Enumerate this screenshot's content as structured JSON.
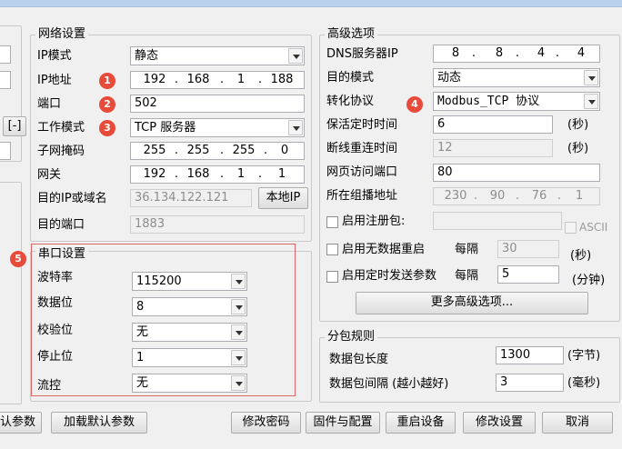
{
  "network": {
    "title": "网络设置",
    "ip_mode_label": "IP模式",
    "ip_mode_value": "静态",
    "ip_label": "IP地址",
    "ip": [
      "192",
      "168",
      "1",
      "188"
    ],
    "port_label": "端口",
    "port_value": "502",
    "work_mode_label": "工作模式",
    "work_mode_value": "TCP 服务器",
    "subnet_label": "子网掩码",
    "subnet": [
      "255",
      "255",
      "255",
      "0"
    ],
    "gateway_label": "网关",
    "gateway": [
      "192",
      "168",
      "1",
      "1"
    ],
    "dest_label": "目的IP或域名",
    "dest_value": "36.134.122.121",
    "local_ip_button": "本地IP",
    "dest_port_label": "目的端口",
    "dest_port_value": "1883"
  },
  "left_partial": {
    "bracket_button": "[-]"
  },
  "serial": {
    "title": "串口设置",
    "baud_label": "波特率",
    "baud_value": "115200",
    "databits_label": "数据位",
    "databits_value": "8",
    "parity_label": "校验位",
    "parity_value": "无",
    "stopbits_label": "停止位",
    "stopbits_value": "1",
    "flow_label": "流控",
    "flow_value": "无"
  },
  "advanced": {
    "title": "高级选项",
    "dns_label": "DNS服务器IP",
    "dns": [
      "8",
      "8",
      "4",
      "4"
    ],
    "dest_mode_label": "目的模式",
    "dest_mode_value": "动态",
    "protocol_label": "转化协议",
    "protocol_value": "Modbus_TCP 协议",
    "keepalive_label": "保活定时时间",
    "keepalive_value": "6",
    "keepalive_unit": "(秒)",
    "reconnect_label": "断线重连时间",
    "reconnect_value": "12",
    "reconnect_unit": "(秒)",
    "webport_label": "网页访问端口",
    "webport_value": "80",
    "multicast_label": "所在组播地址",
    "multicast": [
      "230",
      "90",
      "76",
      "1"
    ],
    "register_label": "启用注册包:",
    "ascii_label": "ASCII",
    "nodata_restart_label": "启用无数据重启",
    "nodata_interval_label": "每隔",
    "nodata_value": "30",
    "nodata_unit": "(秒)",
    "timed_send_label": "启用定时发送参数",
    "timed_interval_label": "每隔",
    "timed_value": "5",
    "timed_unit": "(分钟)",
    "more_button": "更多高级选项..."
  },
  "packet": {
    "title": "分包规则",
    "length_label": "数据包长度",
    "length_value": "1300",
    "length_unit": "(字节)",
    "interval_label": "数据包间隔 (越小越好)",
    "interval_value": "3",
    "interval_unit": "(毫秒)"
  },
  "badges": [
    "1",
    "2",
    "3",
    "4",
    "5"
  ],
  "buttons": {
    "default_params_partial": "认参数",
    "load_defaults": "加载默认参数",
    "change_password": "修改密码",
    "firmware_config": "固件与配置",
    "restart": "重启设备",
    "modify_settings": "修改设置",
    "cancel": "取消"
  },
  "colors": {
    "badge": "#e84b3a",
    "highlight_border": "#e06666",
    "field_border": "#abadb3"
  }
}
